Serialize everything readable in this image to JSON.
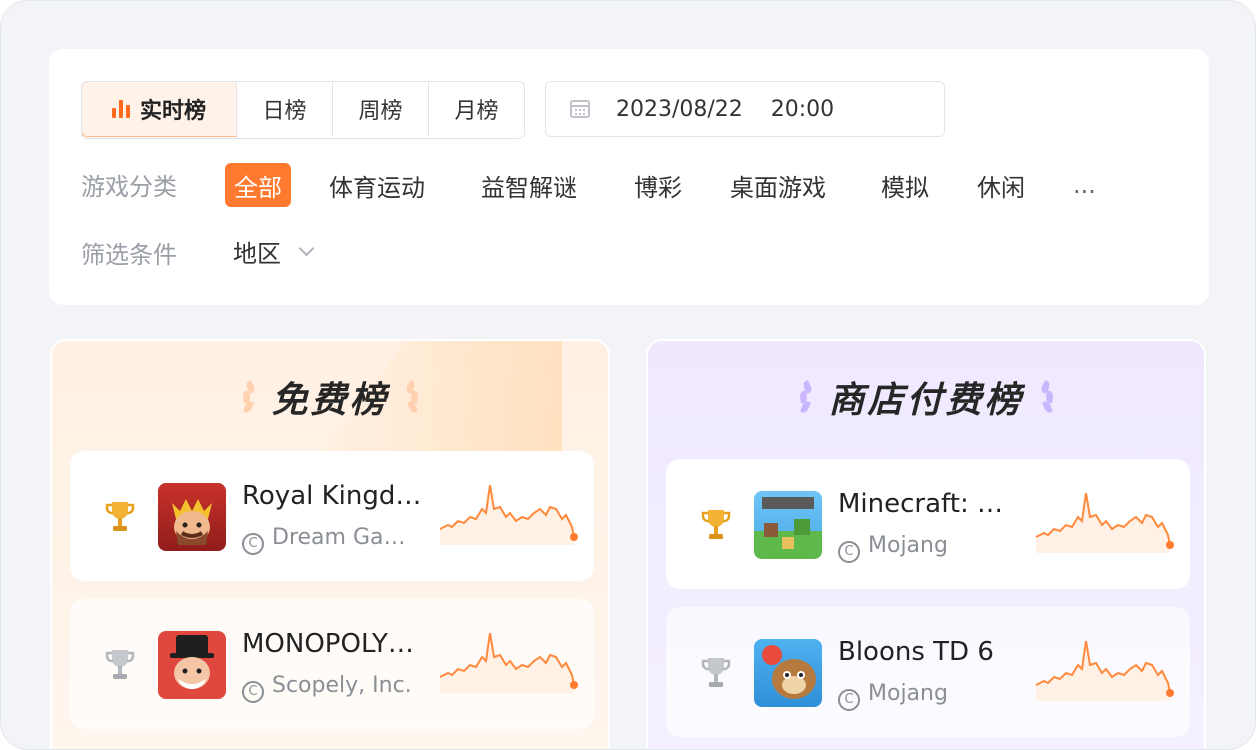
{
  "tabs": [
    {
      "label": "实时榜",
      "active": true
    },
    {
      "label": "日榜",
      "active": false
    },
    {
      "label": "周榜",
      "active": false
    },
    {
      "label": "月榜",
      "active": false
    }
  ],
  "date": {
    "value": "2023/08/22    20:00"
  },
  "category": {
    "label": "游戏分类",
    "items": [
      "全部",
      "体育运动",
      "益智解谜",
      "博彩",
      "桌面游戏",
      "模拟",
      "休闲",
      "..."
    ],
    "active_index": 0
  },
  "filter": {
    "label": "筛选条件",
    "region": "地区"
  },
  "free": {
    "title": "免费榜",
    "items": [
      {
        "name": "Royal Kingdom",
        "developer": "Dream Games",
        "medal": "gold-trophy-icon"
      },
      {
        "name": "MONOPOLY GO!",
        "developer": "Scopely, Inc.",
        "medal": "silver-trophy-icon"
      }
    ]
  },
  "paid": {
    "title": "商店付费榜",
    "items": [
      {
        "name": "Minecraft: Dream it, Build it!",
        "developer": "Mojang",
        "medal": "gold-trophy-icon"
      },
      {
        "name": "Bloons TD 6",
        "developer": "Mojang",
        "medal": "silver-trophy-icon"
      }
    ]
  },
  "colors": {
    "accent": "#ff7a2e",
    "spark": "#ff8a3d",
    "gold": "#f2b233",
    "silver": "#c4c7cc"
  },
  "copyright_symbol": "C"
}
